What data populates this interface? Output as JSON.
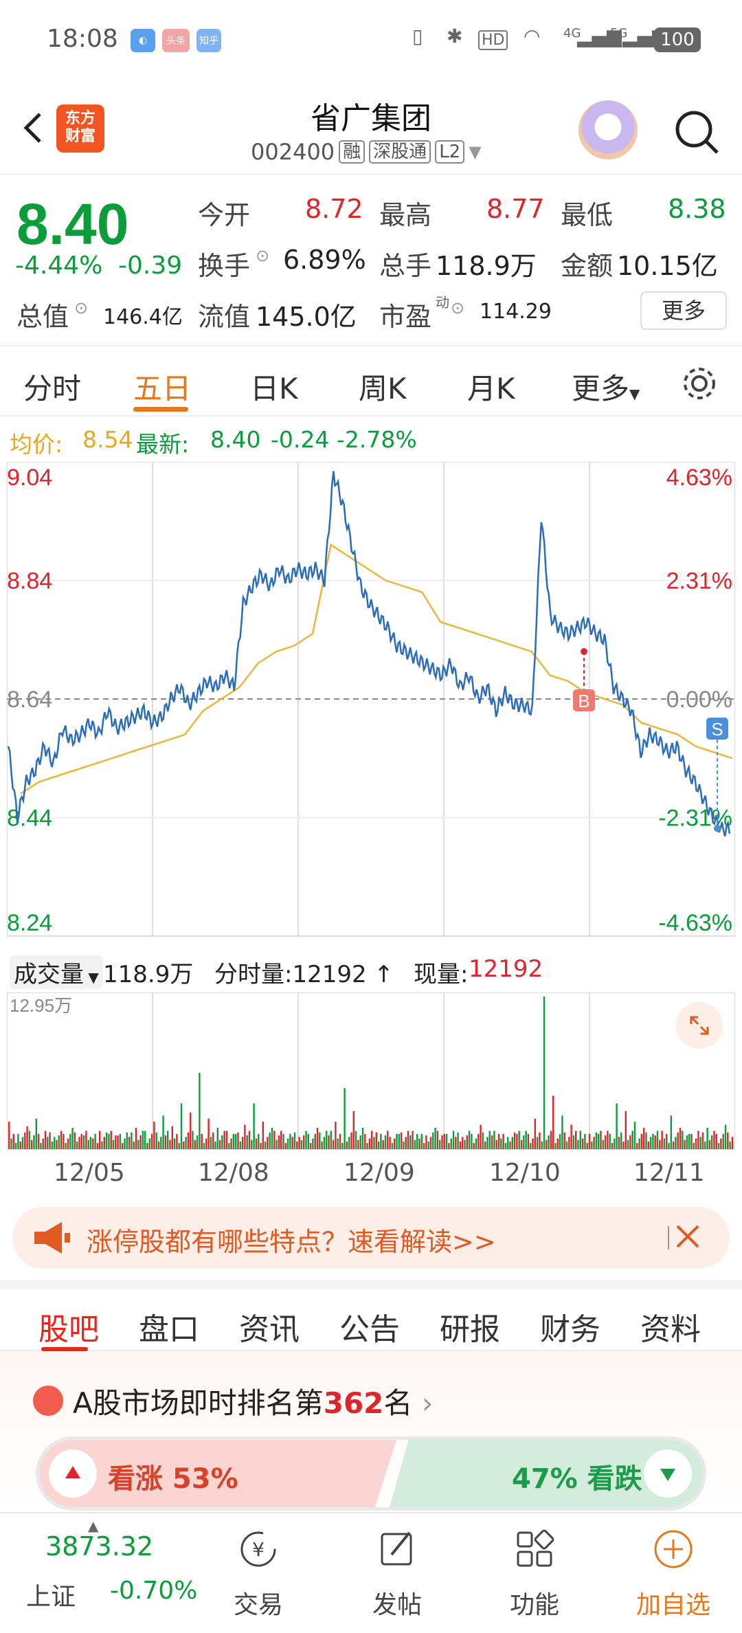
{
  "status_bar": {
    "time": "18:08",
    "apps": [
      "头条",
      "知乎"
    ],
    "battery": "100",
    "network_labels": [
      "HD",
      "4G",
      "5G"
    ]
  },
  "header": {
    "logo_text_line1": "东方",
    "logo_text_line2": "财富",
    "stock_name": "省广集团",
    "stock_code": "002400",
    "tags": [
      "融",
      "深股通",
      "L2"
    ]
  },
  "quote": {
    "price": "8.40",
    "change_pct": "-4.44%",
    "change_amt": "-0.39",
    "open_label": "今开",
    "open": "8.72",
    "high_label": "最高",
    "high": "8.77",
    "low_label": "最低",
    "low": "8.38",
    "turnover_label": "换手",
    "turnover": "6.89%",
    "volume_label": "总手",
    "volume": "118.9万",
    "amount_label": "金额",
    "amount": "10.15亿",
    "mcap_label": "总值",
    "mcap": "146.4亿",
    "float_label": "流值",
    "float_mcap": "145.0亿",
    "pe_label": "市盈",
    "pe_sup": "动",
    "pe": "114.29",
    "more_button": "更多"
  },
  "period_tabs": [
    "分时",
    "五日",
    "日K",
    "周K",
    "月K",
    "更多"
  ],
  "info_line": {
    "avg_label": "均价:",
    "avg": "8.54",
    "latest_label": "最新:",
    "latest": "8.40",
    "chg": "-0.24",
    "chg_pct": "-2.78%"
  },
  "chart_data": {
    "type": "line",
    "title": "",
    "x_days": [
      "12/05",
      "12/08",
      "12/09",
      "12/10",
      "12/11"
    ],
    "ylim": [
      8.24,
      9.04
    ],
    "y_ticks_left": [
      "9.04",
      "8.84",
      "8.64",
      "8.44",
      "8.24"
    ],
    "y_ticks_right": [
      "4.63%",
      "2.31%",
      "0.00%",
      "-2.31%",
      "-4.63%"
    ],
    "reference_price": 8.64,
    "series": [
      {
        "values": [
          8.56,
          8.44,
          8.5,
          8.52,
          8.56,
          8.53,
          8.59,
          8.57,
          8.58,
          8.6,
          8.58,
          8.62,
          8.59,
          8.6,
          8.61,
          8.62,
          8.6,
          8.61,
          8.64,
          8.66,
          8.63,
          8.65,
          8.67,
          8.66,
          8.68,
          8.66,
          8.8,
          8.83,
          8.85,
          8.83,
          8.86,
          8.84,
          8.86,
          8.85,
          8.86,
          8.84,
          9.02,
          8.97,
          8.9,
          8.83,
          8.8,
          8.78,
          8.76,
          8.73,
          8.72,
          8.71,
          8.7,
          8.69,
          8.68,
          8.7,
          8.66,
          8.68,
          8.64,
          8.66,
          8.62,
          8.65,
          8.63,
          8.63,
          8.62,
          8.95,
          8.78,
          8.76,
          8.75,
          8.76,
          8.77,
          8.75,
          8.74,
          8.66,
          8.64,
          8.62,
          8.55,
          8.58,
          8.57,
          8.55,
          8.56,
          8.52,
          8.5,
          8.47,
          8.44,
          8.42
        ]
      },
      {
        "values": [
          8.48,
          8.5,
          8.51,
          8.52,
          8.53,
          8.54,
          8.55,
          8.56,
          8.57,
          8.58,
          8.62,
          8.64,
          8.66,
          8.7,
          8.72,
          8.73,
          8.75,
          8.9,
          8.88,
          8.86,
          8.84,
          8.83,
          8.82,
          8.77,
          8.76,
          8.75,
          8.74,
          8.73,
          8.72,
          8.68,
          8.67,
          8.65,
          8.64,
          8.63,
          8.6,
          8.59,
          8.58,
          8.56,
          8.55,
          8.54
        ]
      }
    ],
    "markers": [
      {
        "label": "B",
        "price": 8.72
      },
      {
        "label": "S",
        "price": 8.44
      }
    ],
    "grid": true
  },
  "volume": {
    "select_label": "成交量",
    "total": "118.9万",
    "tick_label": "分时量:12192",
    "now_label": "现量:",
    "now": "12192",
    "max_label": "12.95万",
    "bars": [
      0.18,
      0.1,
      0.15,
      0.2,
      0.12,
      0.08,
      0.1,
      0.14,
      0.1,
      0.08,
      0.12,
      0.1,
      0.09,
      0.11,
      0.14,
      0.12,
      0.18,
      0.22,
      0.15,
      0.3,
      0.24,
      0.5,
      0.2,
      0.14,
      0.12,
      0.1,
      0.16,
      0.3,
      0.18,
      0.14,
      0.12,
      0.1,
      0.08,
      0.1,
      0.14,
      0.12,
      0.18,
      0.4,
      0.25,
      0.14,
      0.12,
      0.1,
      0.08,
      0.1,
      0.12,
      0.1,
      0.09,
      0.14,
      0.1,
      0.12,
      0.08,
      0.1,
      0.16,
      0.12,
      0.1,
      0.08,
      0.1,
      0.12,
      0.2,
      1.0,
      0.35,
      0.22,
      0.16,
      0.12,
      0.1,
      0.1,
      0.12,
      0.3,
      0.25,
      0.18,
      0.14,
      0.1,
      0.12,
      0.22,
      0.14,
      0.1,
      0.12,
      0.14,
      0.1,
      0.16
    ]
  },
  "dates": [
    "12/05",
    "12/08",
    "12/09",
    "12/10",
    "12/11"
  ],
  "banner": {
    "text": "涨停股都有哪些特点？速看解读>>"
  },
  "section_tabs": [
    "股吧",
    "盘口",
    "资讯",
    "公告",
    "研报",
    "财务",
    "资料"
  ],
  "rank": {
    "prefix": "A股市场即时排名第",
    "number": "362",
    "suffix": "名",
    "up_label": "看涨 53%",
    "down_label": "47% 看跌"
  },
  "bottom_nav": {
    "index_value": "3873.32",
    "index_name": "上证",
    "index_change": "-0.70%",
    "items": [
      "交易",
      "发帖",
      "功能",
      "加自选"
    ]
  },
  "colors": {
    "up": "#e0252a",
    "down": "#0a9d3a",
    "accent": "#e8761c",
    "price_line": "#2b6cb8",
    "avg_line": "#e8b83c"
  }
}
